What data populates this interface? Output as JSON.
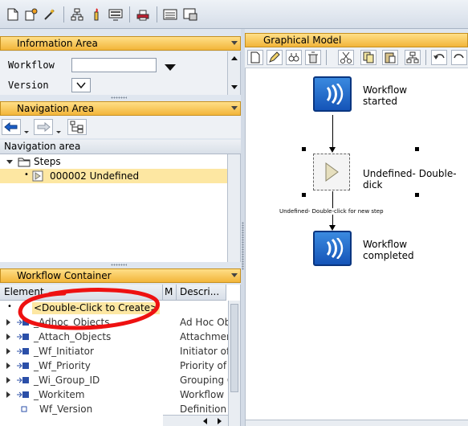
{
  "toolbar": {
    "icons": [
      "new-document-icon",
      "settings-icon",
      "magic-wand-icon",
      "hierarchy-icon",
      "candle-icon",
      "monitor-icon",
      "printer-icon",
      "list-icon",
      "screen-icon"
    ]
  },
  "info_area": {
    "title": "Information Area",
    "workflow_label": "Workflow",
    "version_label": "Version",
    "workflow_value": "",
    "version_value": ""
  },
  "navigation_area": {
    "title": "Navigation Area",
    "list_header": "Navigation area",
    "steps_label": "Steps",
    "step_item": "000002 Undefined"
  },
  "workflow_container": {
    "title": "Workflow Container",
    "col_element": "Element",
    "col_m": "M",
    "col_description": "Descri...",
    "create_label": "<Double-Click to Create>",
    "rows": [
      {
        "element": "_Adhoc_Objects",
        "description": "Ad Hoc Ob"
      },
      {
        "element": "_Attach_Objects",
        "description": "Attachmer"
      },
      {
        "element": "_Wf_Initiator",
        "description": "Initiator of"
      },
      {
        "element": "_Wf_Priority",
        "description": "Priority of V"
      },
      {
        "element": "_Wi_Group_ID",
        "description": "Grouping C"
      },
      {
        "element": "_Workitem",
        "description": "Workflow I"
      },
      {
        "element": "Wf_Version",
        "description": "Definition V"
      }
    ]
  },
  "graphical_model": {
    "title": "Graphical Model",
    "start_label_1": "Workflow",
    "start_label_2": "started",
    "step_label": "Undefined- Double-dick",
    "step_caption": "Undefined- Double-click for new step",
    "end_label_1": "Workflow",
    "end_label_2": "completed"
  },
  "colors": {
    "title_bar": "#f2b53a",
    "selection": "#fde7a2",
    "annotation_red": "#ee1111",
    "node_blue": "#1f66c8"
  }
}
